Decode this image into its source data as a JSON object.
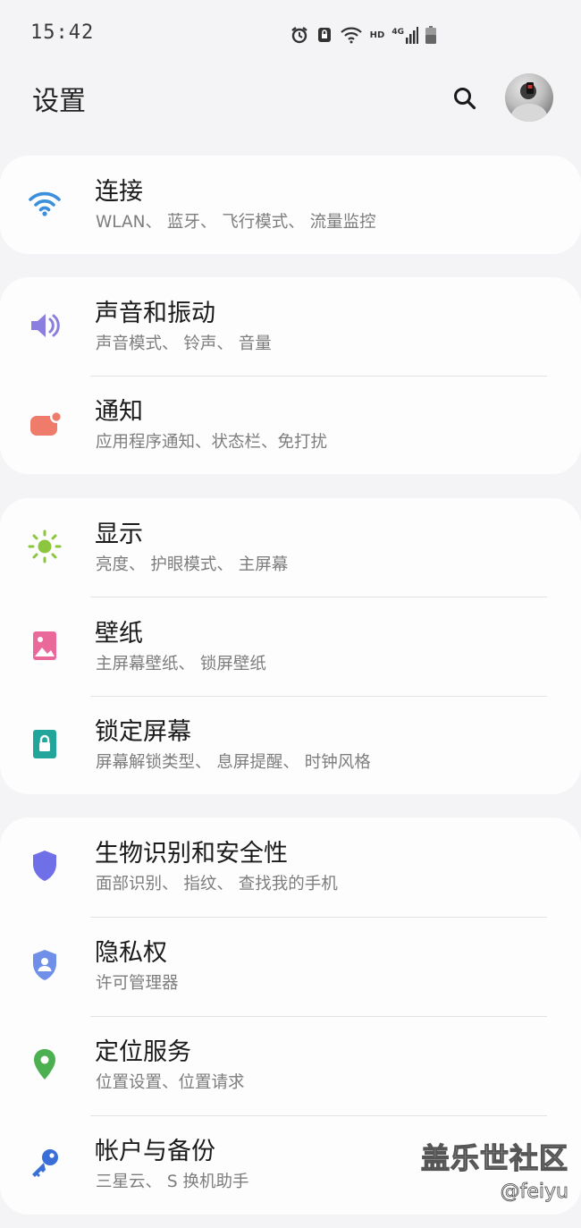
{
  "status_bar": {
    "time": "15:42",
    "hd": "HD",
    "network": "4G"
  },
  "header": {
    "title": "设置"
  },
  "groups": [
    {
      "items": [
        {
          "title": "连接",
          "subtitle": "WLAN、 蓝牙、 飞行模式、 流量监控",
          "icon": "wifi-icon",
          "color": "#3b8fdd"
        }
      ]
    },
    {
      "items": [
        {
          "title": "声音和振动",
          "subtitle": "声音模式、 铃声、 音量",
          "icon": "volume-icon",
          "color": "#8a7fe0"
        },
        {
          "title": "通知",
          "subtitle": "应用程序通知、状态栏、免打扰",
          "icon": "notification-icon",
          "color": "#ef7b6a"
        }
      ]
    },
    {
      "items": [
        {
          "title": "显示",
          "subtitle": "亮度、 护眼模式、 主屏幕",
          "icon": "brightness-icon",
          "color": "#8cc63f"
        },
        {
          "title": "壁纸",
          "subtitle": "主屏幕壁纸、 锁屏壁纸",
          "icon": "wallpaper-icon",
          "color": "#e96a9a"
        },
        {
          "title": "锁定屏幕",
          "subtitle": "屏幕解锁类型、 息屏提醒、 时钟风格",
          "icon": "lock-icon",
          "color": "#22a59a"
        }
      ]
    },
    {
      "items": [
        {
          "title": "生物识别和安全性",
          "subtitle": "面部识别、 指纹、 查找我的手机",
          "icon": "shield-icon",
          "color": "#6f6fe8"
        },
        {
          "title": "隐私权",
          "subtitle": "许可管理器",
          "icon": "privacy-icon",
          "color": "#6f8fe8"
        },
        {
          "title": "定位服务",
          "subtitle": "位置设置、位置请求",
          "icon": "location-icon",
          "color": "#4caf50"
        },
        {
          "title": "帐户与备份",
          "subtitle": "三星云、 S 换机助手",
          "icon": "key-icon",
          "color": "#3b6fd8"
        }
      ]
    }
  ],
  "watermark": {
    "line1": "盖乐世社区",
    "line2": "@feiyu"
  }
}
